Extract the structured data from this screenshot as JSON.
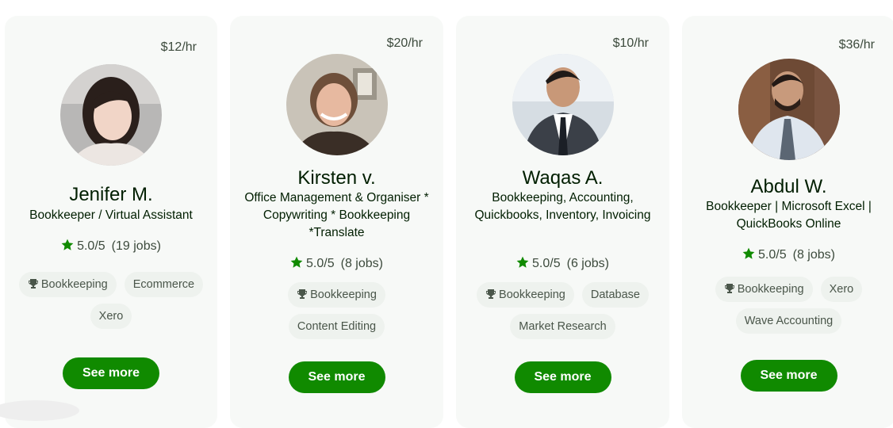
{
  "freelancers": [
    {
      "rate": "$12/hr",
      "name": "Jenifer M.",
      "title": "Bookkeeper / Virtual Assistant",
      "score": "5.0/5",
      "jobs": "(19 jobs)",
      "skills": [
        "Bookkeeping",
        "Ecommerce",
        "Xero"
      ],
      "button": "See more"
    },
    {
      "rate": "$20/hr",
      "name": "Kirsten v.",
      "title": "Office Management & Organiser * Copywriting * Bookkeeping *Translate",
      "score": "5.0/5",
      "jobs": "(8 jobs)",
      "skills": [
        "Bookkeeping",
        "Content Editing"
      ],
      "button": "See more"
    },
    {
      "rate": "$10/hr",
      "name": "Waqas A.",
      "title": "Bookkeeping, Accounting, Quickbooks, Inventory, Invoicing",
      "score": "5.0/5",
      "jobs": "(6 jobs)",
      "skills": [
        "Bookkeeping",
        "Database",
        "Market Research"
      ],
      "button": "See more"
    },
    {
      "rate": "$36/hr",
      "name": "Abdul W.",
      "title": "Bookkeeper | Microsoft Excel | QuickBooks Online",
      "score": "5.0/5",
      "jobs": "(8 jobs)",
      "skills": [
        "Bookkeeping",
        "Xero",
        "Wave Accounting"
      ],
      "button": "See more"
    }
  ],
  "icons": {
    "rating": "star-icon",
    "top_skill": "trophy-icon"
  },
  "colors": {
    "brand_green": "#108a00",
    "card_bg": "#f7f9f7",
    "chip_bg": "#eef2ee"
  }
}
